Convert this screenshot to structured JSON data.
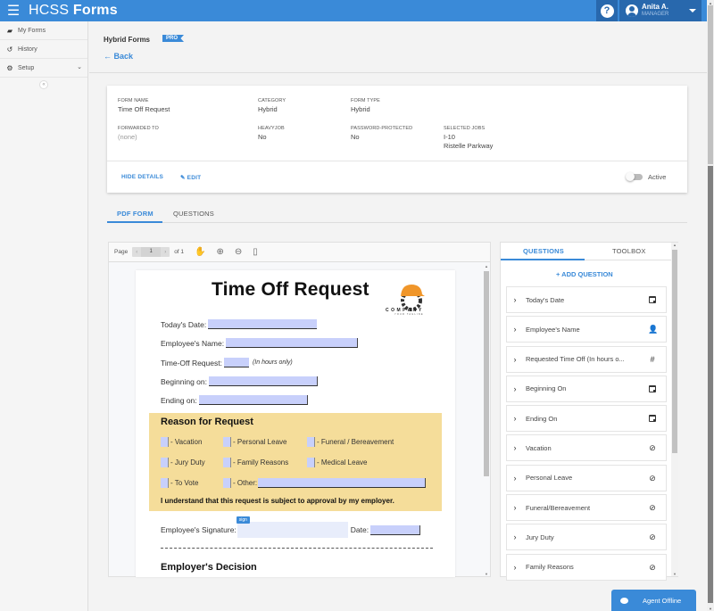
{
  "app": {
    "title_light": "HCSS ",
    "title_bold": "Forms"
  },
  "topbar": {
    "help_icon": "question-circle-icon",
    "user": {
      "name": "Anita A.",
      "role": "MANAGER"
    }
  },
  "sidebar": {
    "items": [
      {
        "label": "My Forms",
        "icon": "folder-open-icon"
      },
      {
        "label": "History",
        "icon": "history-icon"
      },
      {
        "label": "Setup",
        "icon": "gear-icon",
        "expandable": true
      }
    ],
    "collapse_glyph": "«"
  },
  "header": {
    "title": "Hybrid Forms",
    "badge": "PRO",
    "back_label": "← Back"
  },
  "details": {
    "form_name": {
      "label": "FORM NAME",
      "value": "Time Off Request"
    },
    "category": {
      "label": "CATEGORY",
      "value": "Hybrid"
    },
    "form_type": {
      "label": "FORM TYPE",
      "value": "Hybrid"
    },
    "forwarded_to": {
      "label": "FORWARDED TO",
      "value": "(none)"
    },
    "heavyjob": {
      "label": "HEAVYJOB",
      "value": "No"
    },
    "password_protected": {
      "label": "PASSWORD-PROTECTED",
      "value": "No"
    },
    "selected_jobs": {
      "label": "SELECTED JOBS",
      "values": [
        "I-10",
        "Ristelle Parkway"
      ]
    },
    "hide_details_label": "HIDE DETAILS",
    "edit_label": "EDIT",
    "active_label": "Active",
    "active": false
  },
  "tabs": [
    {
      "label": "PDF FORM",
      "active": true
    },
    {
      "label": "QUESTIONS",
      "active": false
    }
  ],
  "pdf_viewer": {
    "page_label": "Page",
    "current_page": "1",
    "of_label": "of 1",
    "prev": "‹",
    "next": "›"
  },
  "pdf_doc": {
    "title": "Time Off Request",
    "logo_text": "COMPANY",
    "logo_tagline": "YOUR TAGLINE",
    "fields": [
      {
        "label": "Today's Date:"
      },
      {
        "label": "Employee's Name:"
      },
      {
        "label": "Time-Off Request:",
        "hint": "(In hours only)"
      },
      {
        "label": "Beginning on:"
      },
      {
        "label": "Ending on:"
      }
    ],
    "reason_title": "Reason for Request",
    "reasons": [
      "- Vacation",
      "- Personal Leave",
      "- Funeral / Bereavement",
      "- Jury Duty",
      "- Family Reasons",
      "- Medical Leave",
      "- To Vote",
      "- Other:"
    ],
    "reason_note": "I understand that this request is subject to approval by my employer.",
    "signature_label": "Employee's Signature:",
    "sign_tag": "sign",
    "date_label": "Date:",
    "employer_decision": "Employer's Decision"
  },
  "questions_panel": {
    "tabs": [
      {
        "label": "QUESTIONS",
        "active": true
      },
      {
        "label": "TOOLBOX",
        "active": false
      }
    ],
    "add_label": "+ ADD QUESTION",
    "items": [
      {
        "label": "Today's Date",
        "icon": "calendar-icon"
      },
      {
        "label": "Employee's Name",
        "icon": "person-icon"
      },
      {
        "label": "Requested Time Off (In hours o...",
        "icon": "hash-icon"
      },
      {
        "label": "Beginning On",
        "icon": "calendar-icon"
      },
      {
        "label": "Ending On",
        "icon": "calendar-icon"
      },
      {
        "label": "Vacation",
        "icon": "check-circle-icon"
      },
      {
        "label": "Personal Leave",
        "icon": "check-circle-icon"
      },
      {
        "label": "Funeral/Bereavement",
        "icon": "check-circle-icon"
      },
      {
        "label": "Jury Duty",
        "icon": "check-circle-icon"
      },
      {
        "label": "Family Reasons",
        "icon": "check-circle-icon"
      }
    ]
  },
  "chat": {
    "label": "Agent Offline"
  },
  "colors": {
    "primary": "#3a8ad8",
    "primary_dark": "#2868ad",
    "reason_bg": "#f5dd9a",
    "field_fill": "#c8d0fb"
  }
}
